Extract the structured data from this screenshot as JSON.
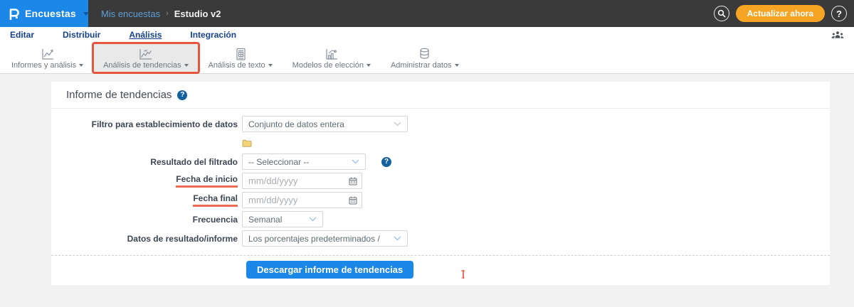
{
  "topbar": {
    "app_label": "Encuestas",
    "breadcrumb": {
      "parent": "Mis encuestas",
      "separator": "›",
      "current": "Estudio v2"
    },
    "update_button": "Actualizar ahora",
    "help_label": "?"
  },
  "nav": {
    "tabs": [
      {
        "label": "Editar",
        "active": false
      },
      {
        "label": "Distribuir",
        "active": false
      },
      {
        "label": "Análisis",
        "active": true
      },
      {
        "label": "Integración",
        "active": false
      }
    ]
  },
  "toolbar": {
    "items": [
      {
        "label": "Informes y análisis",
        "icon": "line-chart-icon",
        "highlighted": false
      },
      {
        "label": "Análisis de tendencias",
        "icon": "trend-chart-icon",
        "highlighted": true
      },
      {
        "label": "Análisis de texto",
        "icon": "text-report-icon",
        "highlighted": false
      },
      {
        "label": "Modelos de elección",
        "icon": "choice-model-icon",
        "highlighted": false
      },
      {
        "label": "Administrar datos",
        "icon": "database-icon",
        "highlighted": false
      }
    ]
  },
  "panel": {
    "title": "Informe de tendencias",
    "help_label": "?",
    "fields": {
      "filtro": {
        "label": "Filtro para establecimiento de datos",
        "value": "Conjunto de datos entera"
      },
      "resultado": {
        "label": "Resultado del filtrado",
        "value": "-- Seleccionar --"
      },
      "fecha_inicio": {
        "label": "Fecha de inicio",
        "placeholder": "mm/dd/yyyy",
        "value": ""
      },
      "fecha_final": {
        "label": "Fecha final",
        "placeholder": "mm/dd/yyyy",
        "value": ""
      },
      "frecuencia": {
        "label": "Frecuencia",
        "value": "Semanal"
      },
      "datos": {
        "label": "Datos de resultado/informe",
        "value": "Los porcentajes predeterminados /"
      }
    },
    "download_button": "Descargar informe de tendencias"
  },
  "colors": {
    "accent_blue": "#1b87e6",
    "button_orange": "#f5a423",
    "annotation_red": "#e8553f",
    "nav_blue": "#16418f",
    "topbar_dark": "#3a3a3a"
  }
}
